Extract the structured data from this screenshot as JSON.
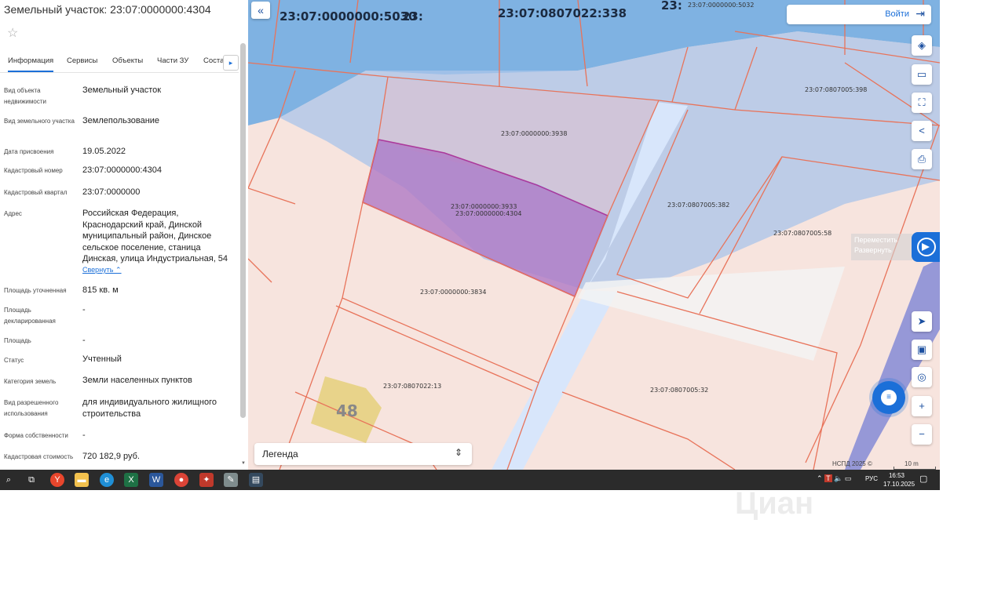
{
  "panel": {
    "title": "Земельный участок: 23:07:0000000:4304",
    "star_icon": "star-icon",
    "tabs": [
      "Информация",
      "Сервисы",
      "Объекты",
      "Части ЗУ",
      "Соста"
    ],
    "tab_next_icon": "chevron-right-icon",
    "rows": [
      {
        "label": "Вид объекта недвижимости",
        "value": "Земельный участок"
      },
      {
        "label": "Вид земельного участка",
        "value": "Землепользование"
      },
      {
        "label": "Дата присвоения",
        "value": "19.05.2022"
      },
      {
        "label": "Кадастровый номер",
        "value": "23:07:0000000:4304"
      },
      {
        "label": "Кадастровый квартал",
        "value": "23:07:0000000"
      },
      {
        "label": "Адрес",
        "value": "Российская Федерация, Краснодарский край, Динской муниципальный район, Динское сельское поселение, станица Динская, улица Индустриальная, 54"
      },
      {
        "label": "Площадь уточненная",
        "value": "815 кв. м"
      },
      {
        "label": "Площадь декларированная",
        "value": "-"
      },
      {
        "label": "Площадь",
        "value": "-"
      },
      {
        "label": "Статус",
        "value": "Учтенный"
      },
      {
        "label": "Категория земель",
        "value": "Земли населенных пунктов"
      },
      {
        "label": "Вид разрешенного использования",
        "value": "для индивидуального жилищного строительства"
      },
      {
        "label": "Форма собственности",
        "value": "-"
      },
      {
        "label": "Кадастровая стоимость",
        "value": "720 182,9 руб."
      }
    ],
    "collapse_link": "Свернуть"
  },
  "map": {
    "collapse_icon": "double-chevron-left-icon",
    "login_label": "Войти",
    "login_icon": "login-icon",
    "top_labels": [
      "23:07:0000000:5030",
      "23:",
      "23:07:0807022:338",
      "23:",
      "23:07:0000000:5032"
    ],
    "plot_labels": [
      "23:07:0807005:398",
      "23:07:0000000:3938",
      "23:07:0000000:3933",
      "23:07:0000000:4304",
      "23:07:0807005:382",
      "23:07:0807005:58",
      "23:07:0000000:3834",
      "23:07:0807022:13",
      "23:07:0807005:32"
    ],
    "building_number": "48",
    "move_tooltip": "Переместить Развернуть",
    "legend_label": "Легенда",
    "copyright": "НСПД 2025 ©",
    "scale": "10 m",
    "toolbar_icons": [
      "layers-icon",
      "ruler-icon",
      "select-area-icon",
      "share-icon",
      "print-icon"
    ],
    "lower_icons": [
      "locate-icon",
      "minimap-icon",
      "geo-search-icon",
      "zoom-in-icon",
      "zoom-out-icon"
    ],
    "colors": {
      "selected": "#b07ac6",
      "border": "#e8735a",
      "water": "#8cb8e6",
      "road": "#cfe2fb"
    }
  },
  "taskbar": {
    "icons": [
      "search-icon",
      "task-view-icon",
      "yandex-browser-icon",
      "file-explorer-icon",
      "edge-icon",
      "excel-icon",
      "word-icon",
      "chrome-icon",
      "app-icon",
      "app2-icon",
      "app3-icon"
    ],
    "lang": "РУС",
    "time": "16:53",
    "date": "17.10.2025"
  },
  "watermark": "Циан"
}
